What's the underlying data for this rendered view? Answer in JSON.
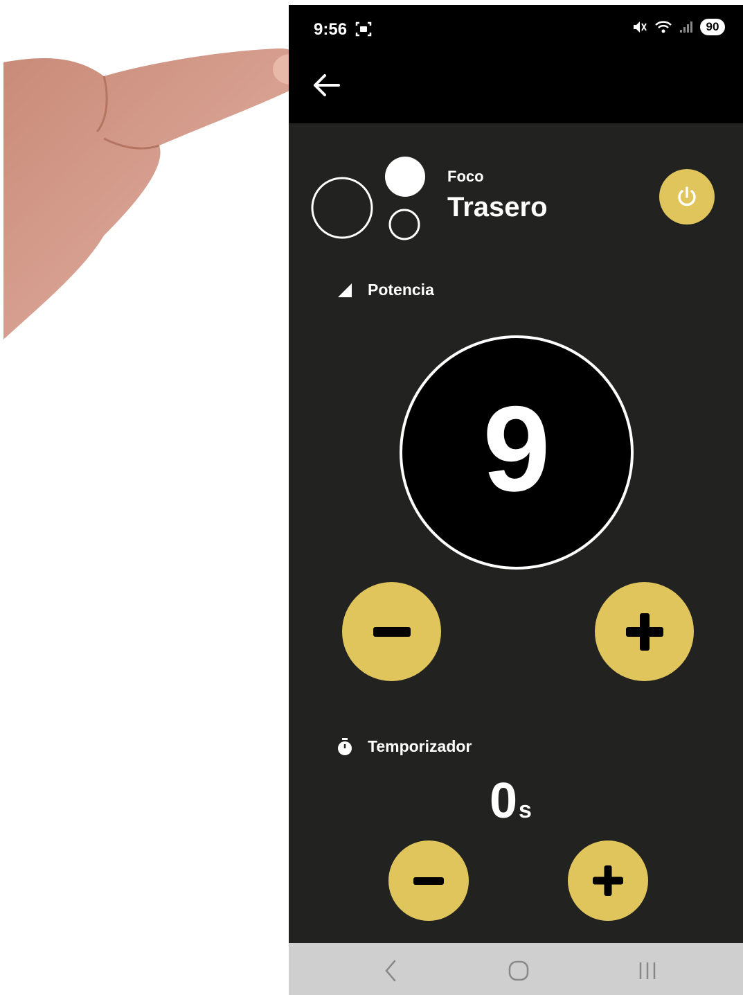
{
  "status_bar": {
    "time": "9:56",
    "battery": "90"
  },
  "device": {
    "label": "Foco",
    "name": "Trasero"
  },
  "power_section": {
    "title": "Potencia",
    "level": "9"
  },
  "timer_section": {
    "title": "Temporizador",
    "value": "0",
    "unit": "s"
  },
  "colors": {
    "accent": "#e0c55c",
    "background": "#222220",
    "header": "#000000",
    "navbar": "#cfcfcf"
  },
  "icons": {
    "back": "arrow-left-icon",
    "power": "power-icon",
    "signal": "signal-triangle-icon",
    "timer": "stopwatch-icon",
    "minus": "minus-icon",
    "plus": "plus-icon"
  }
}
